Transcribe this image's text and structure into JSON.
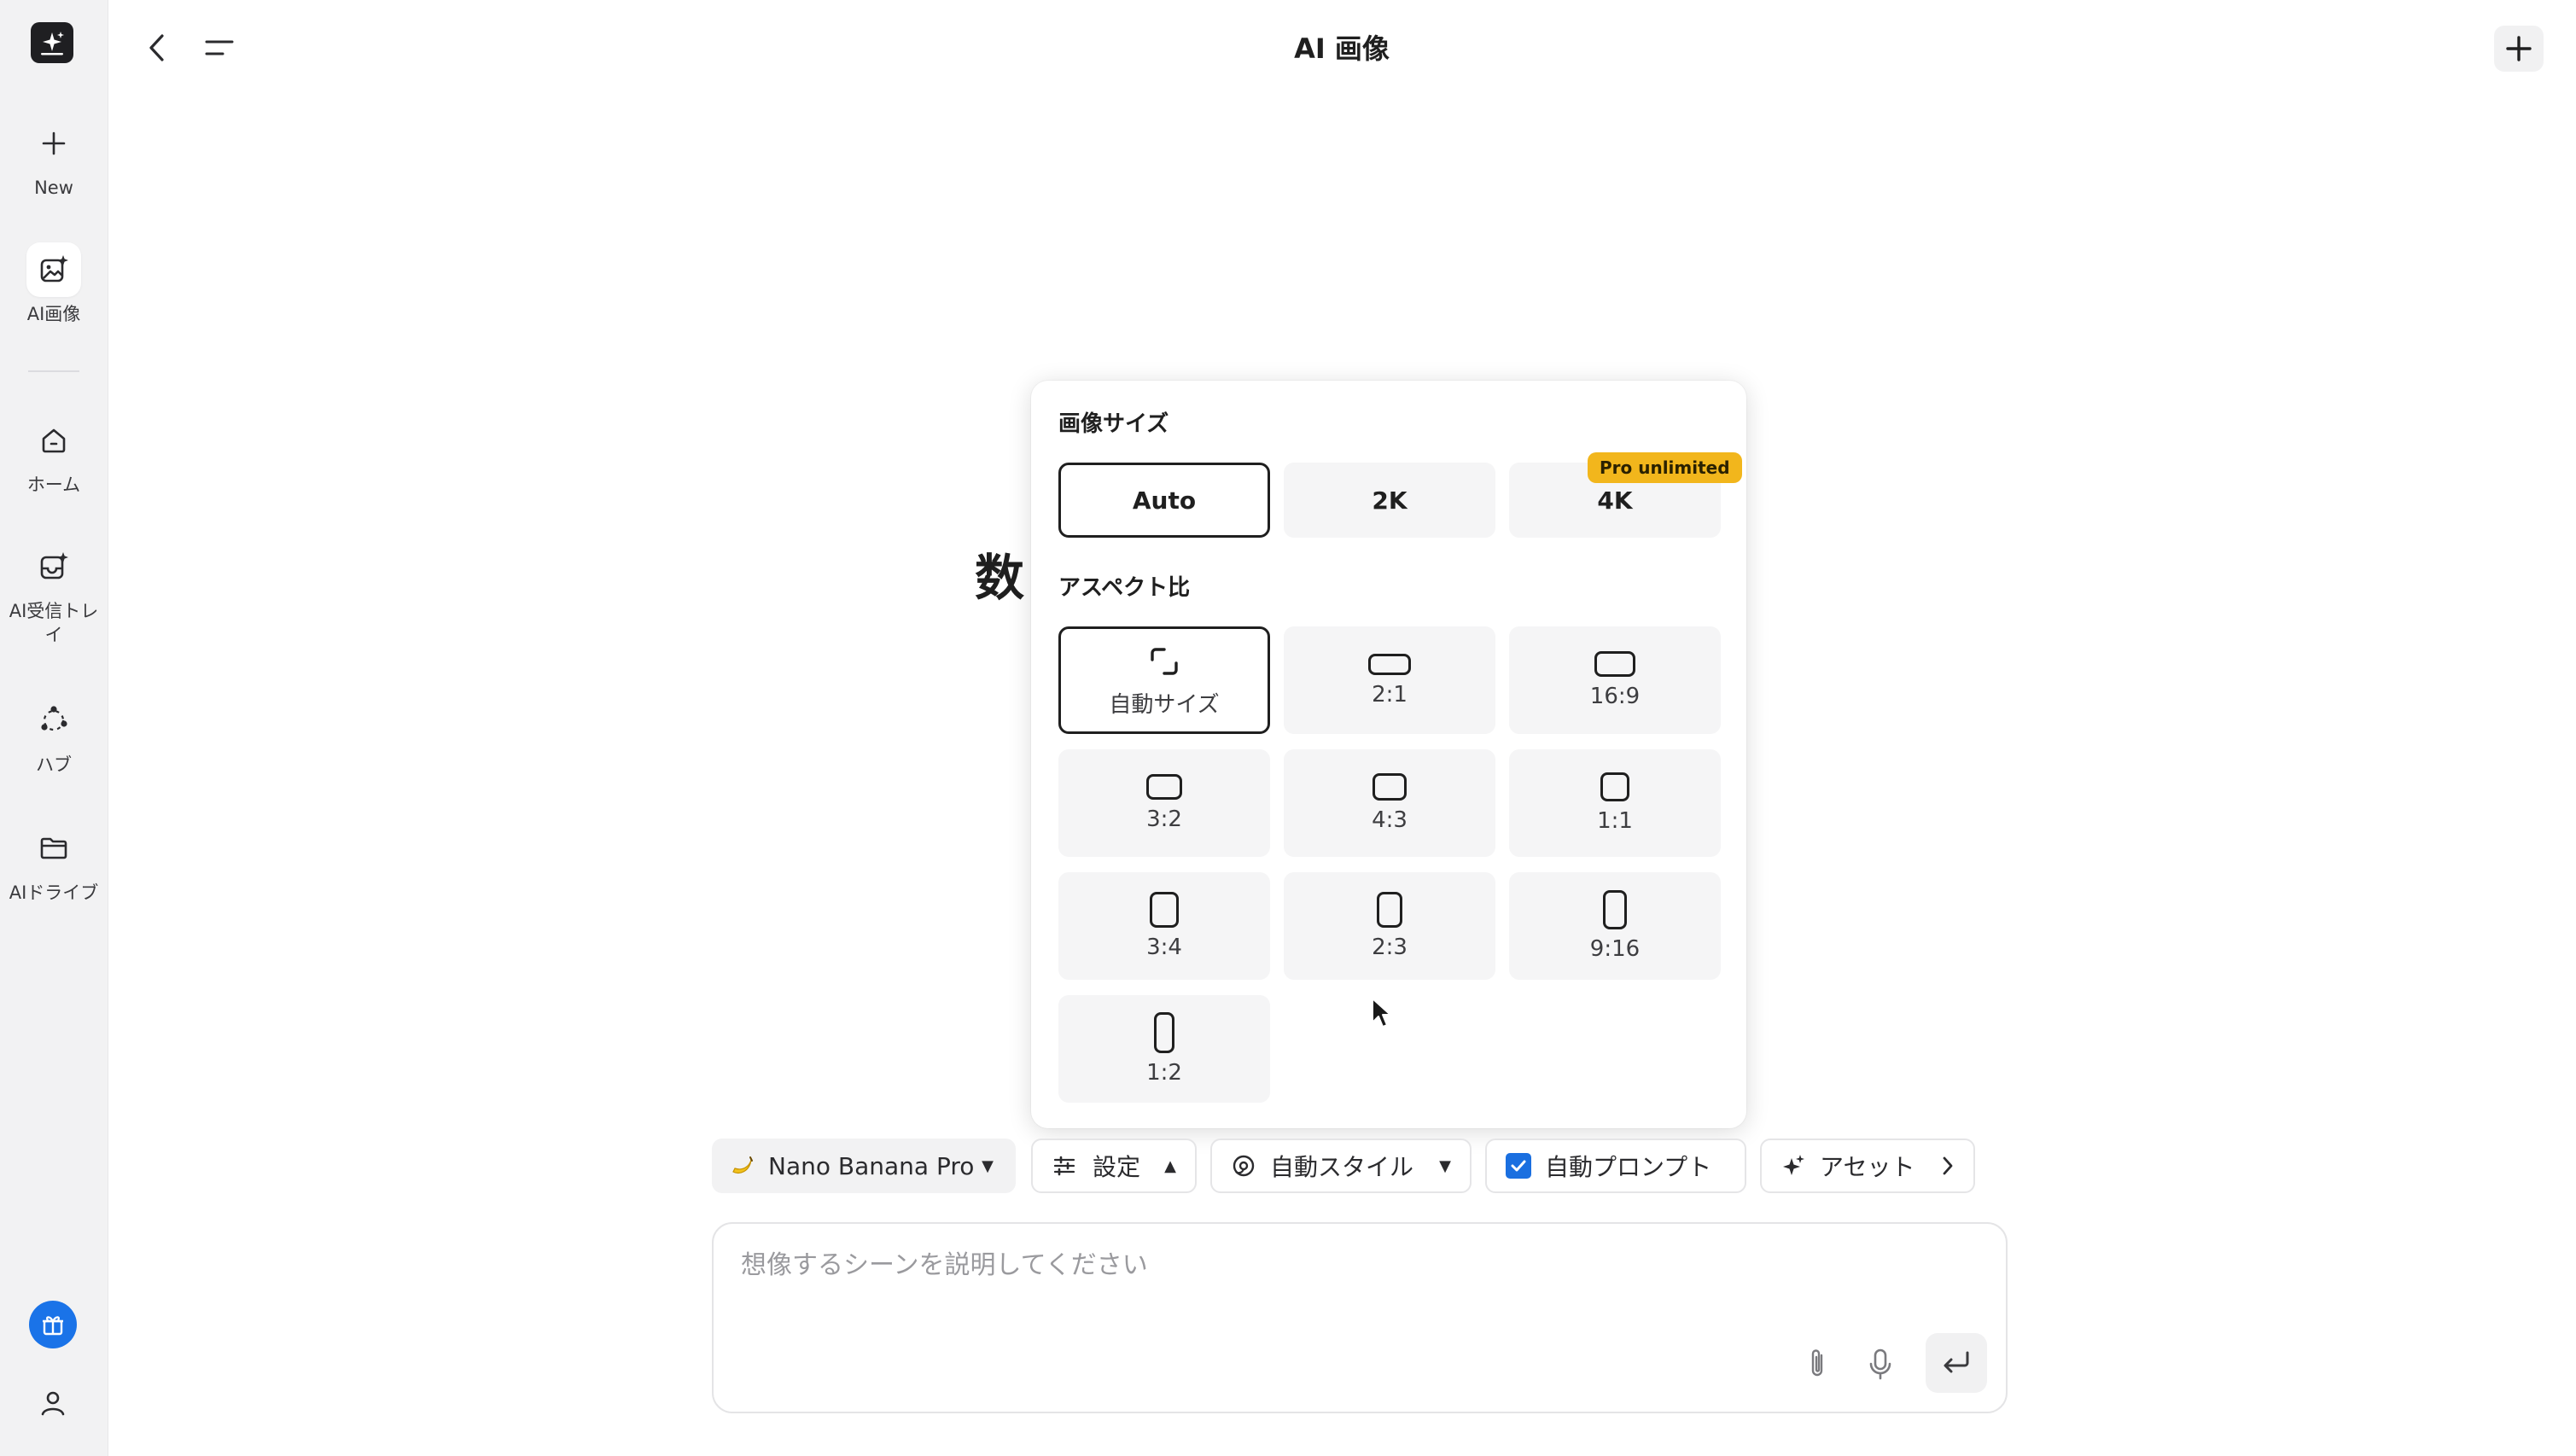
{
  "sidebar": {
    "items": [
      {
        "label": "New",
        "icon": "plus-icon"
      },
      {
        "label": "AI画像",
        "icon": "ai-image-icon"
      },
      {
        "label": "ホーム",
        "icon": "home-icon"
      },
      {
        "label": "AI受信トレイ",
        "icon": "inbox-icon"
      },
      {
        "label": "ハブ",
        "icon": "hub-icon"
      },
      {
        "label": "AIドライブ",
        "icon": "folder-icon"
      }
    ]
  },
  "header": {
    "title": "AI 画像"
  },
  "background_heading": "数",
  "popover": {
    "image_size": {
      "title": "画像サイズ",
      "options": [
        "Auto",
        "2K",
        "4K"
      ],
      "selected": "Auto",
      "badge": "Pro unlimited"
    },
    "aspect_ratio": {
      "title": "アスペクト比",
      "options": [
        "自動サイズ",
        "2:1",
        "16:9",
        "3:2",
        "4:3",
        "1:1",
        "3:4",
        "2:3",
        "9:16",
        "1:2"
      ],
      "selected": "自動サイズ"
    }
  },
  "toolbar": {
    "model": "Nano Banana Pro",
    "settings": "設定",
    "style": "自動スタイル",
    "auto_prompt": "自動プロンプト",
    "auto_prompt_checked": true,
    "assets": "アセット"
  },
  "prompt": {
    "placeholder": "想像するシーンを説明してください",
    "value": ""
  },
  "colors": {
    "accent": "#1a6fe0",
    "badge": "#f2b61c",
    "sidebar_bg": "#f2f2f3"
  }
}
